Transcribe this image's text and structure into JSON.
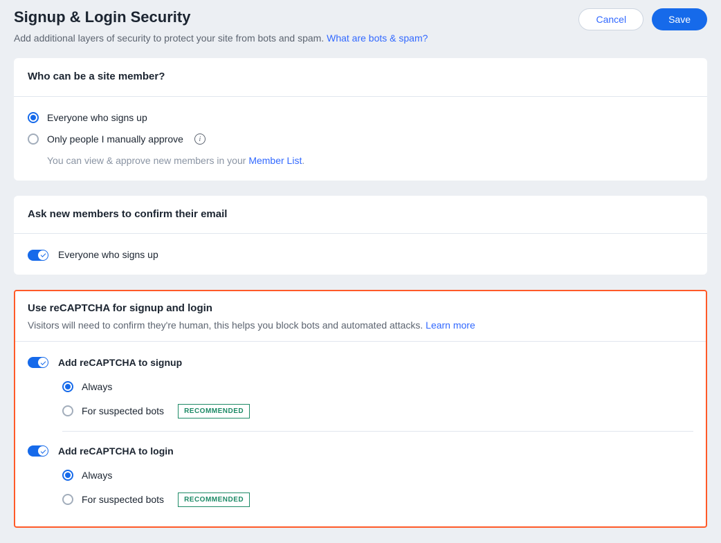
{
  "header": {
    "title": "Signup & Login Security",
    "subtitle": "Add additional layers of security to protect your site from bots and spam. ",
    "help_link": "What are bots & spam?",
    "cancel": "Cancel",
    "save": "Save"
  },
  "membership": {
    "title": "Who can be a site member?",
    "option_everyone": "Everyone who signs up",
    "option_approve": "Only people I manually approve",
    "approve_help": "You can view & approve new members in your ",
    "approve_link": "Member List"
  },
  "email_confirm": {
    "title": "Ask new members to confirm their email",
    "toggle_label": "Everyone who signs up"
  },
  "recaptcha": {
    "title": "Use reCAPTCHA for signup and login",
    "subtitle": "Visitors will need to confirm they're human, this helps you block bots and automated attacks. ",
    "learn_more": "Learn more",
    "signup": {
      "label": "Add reCAPTCHA to signup",
      "always": "Always",
      "suspected": "For suspected bots",
      "badge": "RECOMMENDED"
    },
    "login": {
      "label": "Add reCAPTCHA to login",
      "always": "Always",
      "suspected": "For suspected bots",
      "badge": "RECOMMENDED"
    }
  }
}
